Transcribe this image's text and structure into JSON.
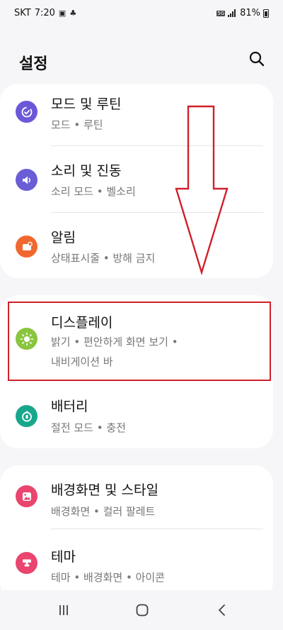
{
  "status_bar": {
    "carrier": "SKT",
    "time": "7:20",
    "network_badge": "5G",
    "battery": "81%"
  },
  "header": {
    "title": "설정",
    "search_icon": "search-icon"
  },
  "items": [
    {
      "title": "모드 및 루틴",
      "subtitle": "모드 • 루틴",
      "icon": "mode-routine-icon",
      "color": "#6b58d8"
    },
    {
      "title": "소리 및 진동",
      "subtitle": "소리 모드 • 벨소리",
      "icon": "sound-icon",
      "color": "#6a5ed6"
    },
    {
      "title": "알림",
      "subtitle": "상태표시줄 • 방해 금지",
      "icon": "notification-icon",
      "color": "#f0682f"
    },
    {
      "title": "디스플레이",
      "subtitle": "밝기 • 편안하게 화면 보기 •",
      "subtitle2": "내비게이션 바",
      "icon": "display-sun-icon",
      "color": "#8ac53e"
    },
    {
      "title": "배터리",
      "subtitle": "절전 모드 • 충전",
      "icon": "battery-icon",
      "color": "#17a78d"
    },
    {
      "title": "배경화면 및 스타일",
      "subtitle": "배경화면 • 컬러 팔레트",
      "icon": "wallpaper-icon",
      "color": "#e9456e"
    },
    {
      "title": "테마",
      "subtitle": "테마 • 배경화면 • 아이콘",
      "icon": "theme-icon",
      "color": "#e9456e"
    }
  ],
  "colors": {
    "annotation": "#d0202a",
    "background": "#f6f6f8",
    "card": "#ffffff"
  }
}
